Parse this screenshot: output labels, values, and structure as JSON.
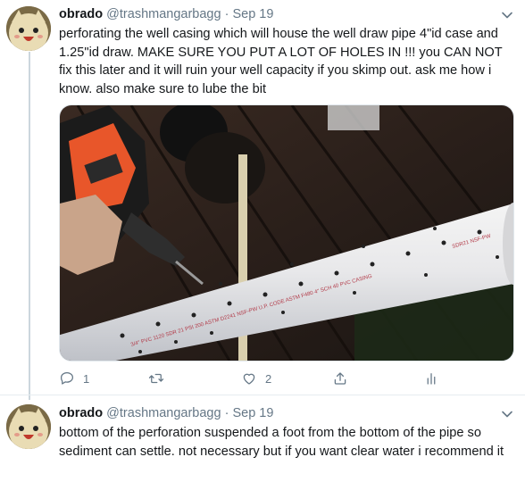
{
  "tweets": [
    {
      "name": "obrado",
      "handle": "@trashmangarbagg",
      "separator": "·",
      "date": "Sep 19",
      "text": "perforating the well casing which will house the well draw pipe 4\"id case and 1.25\"id draw. MAKE SURE YOU PUT A LOT OF HOLES IN !!! you CAN NOT fix this later and it will ruin your well capacity if you skimp out. ask me how i know. also make sure to lube the bit",
      "media": {
        "pipe_print": "3/4\" PVC 1120 SDR 21 PSI 200 ASTM D2241 NSF-PW U.P. CODE ASTM F480 4\" SCH 40 PVC CASING",
        "pipe_print_right": "SDR21 NSF-PW"
      },
      "actions": {
        "reply_count": "1",
        "retweet_count": "",
        "like_count": "2"
      }
    },
    {
      "name": "obrado",
      "handle": "@trashmangarbagg",
      "separator": "·",
      "date": "Sep 19",
      "text": "bottom of the perforation suspended a foot from the bottom of the pipe so sediment can settle. not necessary but if you want clear water i recommend it"
    }
  ],
  "colors": {
    "text": "#14171a",
    "secondary": "#657786",
    "thread_line": "#ccd6dd",
    "drill_orange": "#e8562a"
  }
}
